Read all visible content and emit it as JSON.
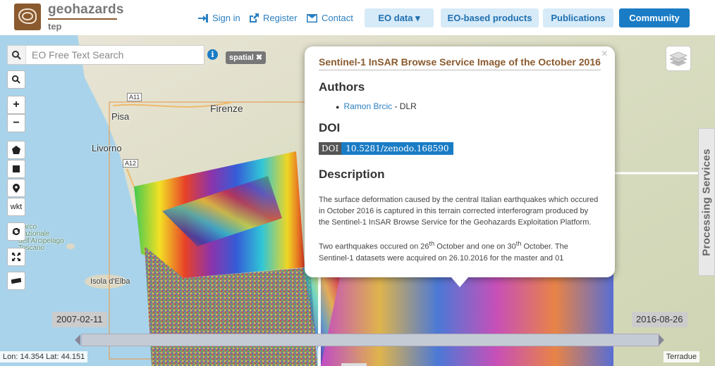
{
  "brand": {
    "name": "geohazards",
    "sub": "tep"
  },
  "nav": {
    "signin": "Sign in",
    "register": "Register",
    "contact": "Contact",
    "eo_data": "EO data ▾",
    "eo_products": "EO-based products",
    "publications": "Publications",
    "community": "Community"
  },
  "map": {
    "search_placeholder": "EO Free Text Search",
    "spatial_tag": "spatial ✖",
    "tools": {
      "wkt": "wkt"
    },
    "labels": {
      "firenze": "Firenze",
      "pisa": "Pisa",
      "livorno": "Livorno",
      "elba": "Isola d'Elba",
      "parco": "Parco\nNazionale\ndell'Arcipelago\nToscano"
    },
    "roads": [
      "A11",
      "A12"
    ],
    "processing_services": "Processing Services",
    "date_start": "2007-02-11",
    "date_end": "2016-08-26",
    "coords": "Lon: 14.354 Lat: 44.151",
    "attribution": "Terradue"
  },
  "popup": {
    "title": "Sentinel-1 InSAR Browse Service Image of the October 2016",
    "close": "×",
    "authors_heading": "Authors",
    "author_name": "Ramon Brcic",
    "author_org": " - DLR",
    "doi_heading": "DOI",
    "doi_label": "DOI",
    "doi_value": "10.5281/zenodo.168590",
    "description_heading": "Description",
    "description_1": "The surface deformation caused by the central Italian earthquakes which occured in October 2016 is captured in this terrain corrected interferogram produced by the Sentinel-1 InSAR Browse Service for the Geohazards Exploitation Platform.",
    "description_2_a": "Two earthquakes occured on 26",
    "description_2_sup1": "th",
    "description_2_b": " October and one on 30",
    "description_2_sup2": "th",
    "description_2_c": " October. The Sentinel-1 datasets were acquired on 26.10.2016 for the master and 01"
  },
  "colors": {
    "brand_brown": "#8a5a2e",
    "accent_blue": "#1a7cc5"
  }
}
